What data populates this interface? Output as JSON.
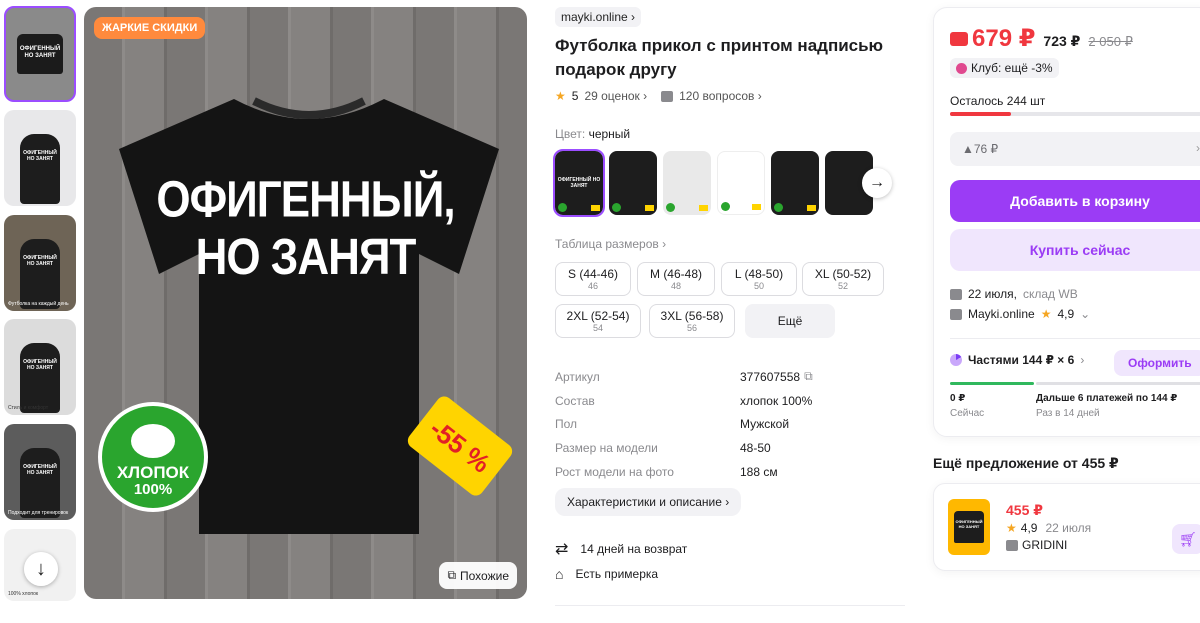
{
  "gallery": {
    "hot_badge": "ЖАРКИЕ СКИДКИ",
    "tee_text_line1": "ОФИГЕННЫЙ,",
    "tee_text_line2": "НО ЗАНЯТ",
    "cotton_line1": "ХЛОПОК",
    "cotton_line2": "100%",
    "discount_tag": "-55 %",
    "similar_label": "Похожие",
    "thumb_text": "ОФИГЕННЫЙ НО ЗАНЯТ",
    "thumb_captions": [
      "",
      "",
      "Футболка на каждый день",
      "Стиль и комфорт",
      "Подходит для тренировок",
      "100% хлопок"
    ]
  },
  "product": {
    "brand": "mayki.online",
    "title": "Футболка прикол с принтом надписью подарок другу",
    "rating": "5",
    "reviews": "29 оценок",
    "questions": "120 вопросов",
    "color_label": "Цвет:",
    "color_value": "черный",
    "size_table_label": "Таблица размеров",
    "sizes": [
      {
        "label": "S (44-46)",
        "ru": "46"
      },
      {
        "label": "M (46-48)",
        "ru": "48"
      },
      {
        "label": "L (48-50)",
        "ru": "50"
      },
      {
        "label": "XL (50-52)",
        "ru": "52"
      },
      {
        "label": "2XL (52-54)",
        "ru": "54"
      },
      {
        "label": "3XL (56-58)",
        "ru": "56"
      }
    ],
    "more_sizes": "Ещё",
    "specs": [
      {
        "k": "Артикул",
        "v": "377607558"
      },
      {
        "k": "Состав",
        "v": "хлопок 100%"
      },
      {
        "k": "Пол",
        "v": "Мужской"
      },
      {
        "k": "Размер на модели",
        "v": "48-50"
      },
      {
        "k": "Рост модели на фото",
        "v": "188 см"
      }
    ],
    "char_button": "Характеристики и описание",
    "features": [
      "14 дней на возврат",
      "Есть примерка"
    ]
  },
  "buy": {
    "price": "679 ₽",
    "price_wallet": "723 ₽",
    "price_old": "2 050 ₽",
    "club": "Клуб: ещё -3%",
    "stock": "Осталось 244 шт",
    "stock_fraction": 0.235,
    "coins": "▲76 ₽",
    "add_to_cart": "Добавить в корзину",
    "buy_now": "Купить сейчас",
    "delivery_date": "22 июля,",
    "delivery_wh": "склад WB",
    "seller": "Mayki.online",
    "seller_rating": "4,9",
    "installments": "Частями 144 ₽ × 6",
    "installments_btn": "Оформить",
    "pay_now_amount": "0 ₽",
    "pay_now_label": "Сейчас",
    "pay_later_amount": "Дальше 6 платежей по 144 ₽",
    "pay_later_label": "Раз в 14 дней"
  },
  "other": {
    "title": "Ещё предложение от 455 ₽",
    "price": "455 ₽",
    "rating": "4,9",
    "date": "22 июля",
    "seller": "GRIDINI"
  },
  "colors": {
    "accent": "#9b3cf5",
    "price_red": "#f0373f",
    "green": "#30b85d"
  }
}
